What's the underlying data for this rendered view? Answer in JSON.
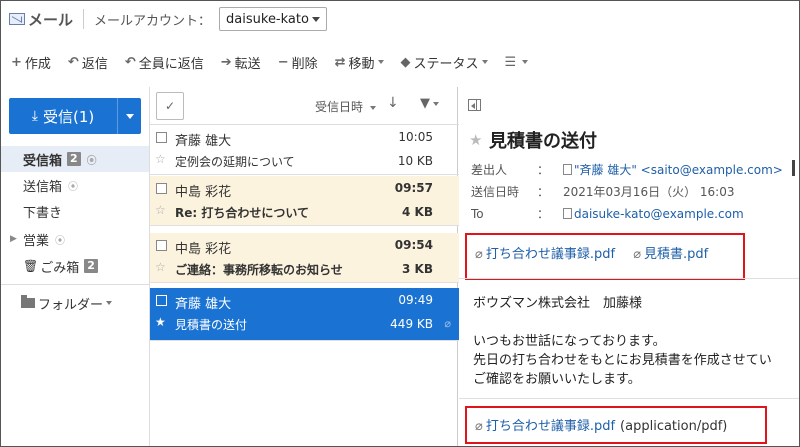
{
  "app": {
    "title": "メール",
    "account_label": "メールアカウント：",
    "account_value": "daisuke-kato"
  },
  "toolbar": {
    "items": [
      {
        "icon": "plus-icon",
        "glyph": "+",
        "label": "作成"
      },
      {
        "icon": "reply-icon",
        "glyph": "↶",
        "label": "返信"
      },
      {
        "icon": "reply-all-icon",
        "glyph": "↶",
        "label": "全員に返信"
      },
      {
        "icon": "forward-icon",
        "glyph": "➔",
        "label": "転送"
      },
      {
        "icon": "delete-icon",
        "glyph": "−",
        "label": "削除"
      },
      {
        "icon": "move-icon",
        "glyph": "⇄",
        "label": "移動"
      },
      {
        "icon": "tag-icon",
        "glyph": "◆",
        "label": "ステータス"
      },
      {
        "icon": "menu-icon",
        "glyph": "☰",
        "label": ""
      }
    ]
  },
  "sidebar": {
    "receive_label": "受信(1)",
    "folders": [
      {
        "name": "受信箱",
        "badge": "2"
      },
      {
        "name": "送信箱"
      },
      {
        "name": "下書き"
      },
      {
        "name": "営業"
      },
      {
        "name": "ごみ箱",
        "badge": "2"
      }
    ],
    "folders_menu_label": "フォルダー"
  },
  "list": {
    "sort_label": "受信日時",
    "messages": [
      {
        "from": "斉藤 雄大",
        "subject": "定例会の延期について",
        "time": "10:05",
        "size": "10 KB",
        "state": "read"
      },
      {
        "from": "中島 彩花",
        "subject": "Re: 打ち合わせについて",
        "time": "09:57",
        "size": "4 KB",
        "state": "unread"
      },
      {
        "from": "中島 彩花",
        "subject": "ご連絡：事務所移転のお知らせ",
        "time": "09:54",
        "size": "3 KB",
        "state": "unread"
      },
      {
        "from": "斉藤 雄大",
        "subject": "見積書の送付",
        "time": "09:49",
        "size": "449 KB",
        "state": "selected",
        "has_attachment": true
      }
    ]
  },
  "detail": {
    "subject": "見積書の送付",
    "from_label": "差出人",
    "from_value": "\"斉藤 雄大\" <saito@example.com>",
    "date_label": "送信日時",
    "date_value": "2021年03月16日（火） 16:03",
    "to_label": "To",
    "to_value": "daisuke-kato@example.com",
    "colon": "：",
    "attachments": [
      "打ち合わせ議事録.pdf",
      "見積書.pdf"
    ],
    "body_lines": [
      "ボウズマン株式会社　加藤様",
      "いつもお世話になっております。",
      "先日の打ち合わせをもとにお見積書を作成させてい",
      "ご確認をお願いいたします。"
    ],
    "bottom_attachment": "打ち合わせ議事録.pdf",
    "bottom_attachment_type": "(application/pdf)"
  },
  "colors": {
    "accent": "#1a73d2",
    "unread_bg": "#fcf3df",
    "highlight_border": "#e0151b",
    "link": "#1f5fa8"
  }
}
